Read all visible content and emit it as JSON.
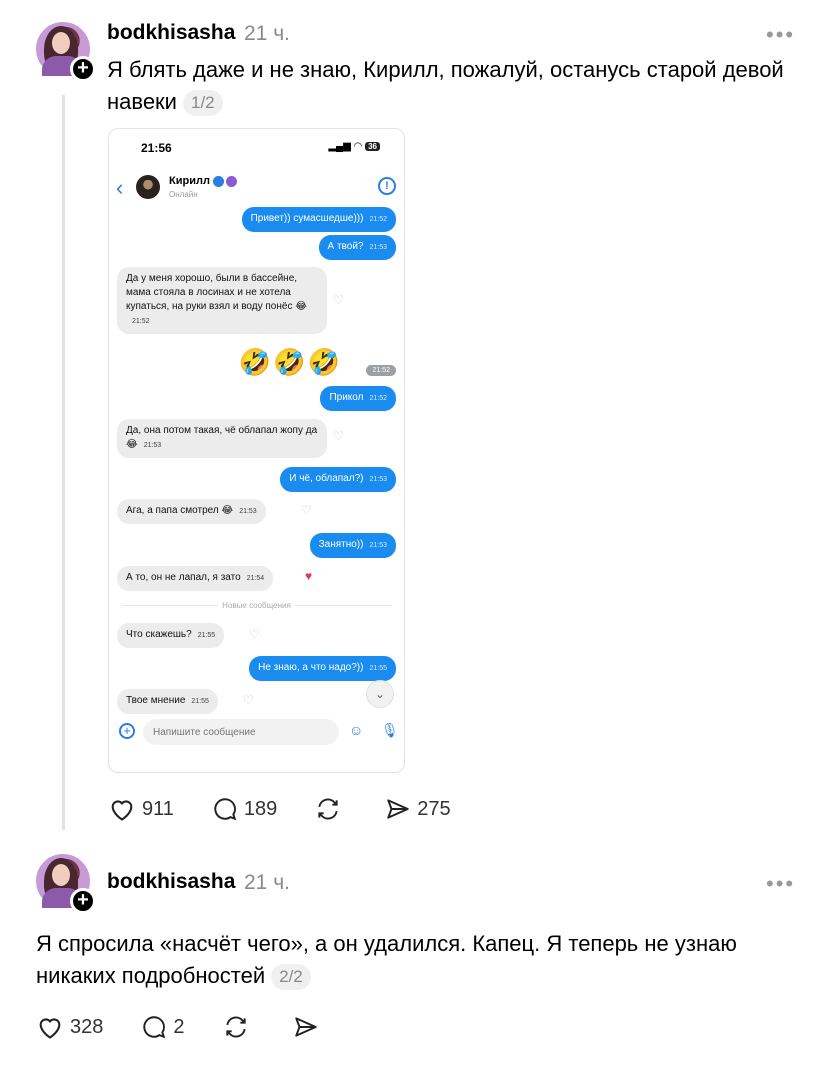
{
  "post1": {
    "username": "bodkhisasha",
    "time": "21 ч.",
    "more": "•••",
    "text": "Я блять даже и не знаю, Кирилл, пожалуй, останусь старой девой навеки",
    "counter": "1/2",
    "likes": "911",
    "replies": "189",
    "shares": "275"
  },
  "screenshot": {
    "clock": "21:56",
    "battery": "36",
    "contact_name": "Кирилл",
    "contact_status": "Онлайн",
    "new_messages_divider": "Новые сообщения",
    "composer_placeholder": "Напишите сообщение",
    "messages": [
      {
        "dir": "out",
        "text": "Привет)) сумасшедше)))",
        "time": "21:52"
      },
      {
        "dir": "out",
        "text": "А твой?",
        "time": "21:53"
      },
      {
        "dir": "in",
        "text": "Да у меня хорошо, были в бассейне, мама стояла в лосинах и не хотела купаться, на руки взял и воду понёс 😂",
        "time": "21:52"
      },
      {
        "dir": "out",
        "text": "🤣🤣🤣",
        "time": "21:52"
      },
      {
        "dir": "out",
        "text": "Прикол",
        "time": "21:52"
      },
      {
        "dir": "in",
        "text": "Да, она потом такая, чё облапал жопу да 😂",
        "time": "21:53"
      },
      {
        "dir": "out",
        "text": "И чё, облапал?)",
        "time": "21:53"
      },
      {
        "dir": "in",
        "text": "Ага, а папа смотрел 😂",
        "time": "21:53"
      },
      {
        "dir": "out",
        "text": "Занятно))",
        "time": "21:53"
      },
      {
        "dir": "in",
        "text": "А то, он не лапал, я зато",
        "time": "21:54"
      },
      {
        "dir": "in",
        "text": "Что скажешь?",
        "time": "21:55"
      },
      {
        "dir": "out",
        "text": "Не знаю, а что надо?))",
        "time": "21:55"
      },
      {
        "dir": "in",
        "text": "Твое мнение",
        "time": "21:55"
      }
    ]
  },
  "post2": {
    "username": "bodkhisasha",
    "time": "21 ч.",
    "more": "•••",
    "text": "Я спросила «насчёт чего», а он удалился. Капец. Я теперь не узнаю никаких подробностей",
    "counter": "2/2",
    "likes": "328",
    "replies": "2"
  },
  "colors": {
    "accent": "#1a8cf0",
    "text": "#000000",
    "muted": "#8a8a8a",
    "heart_red": "#e8344c"
  }
}
